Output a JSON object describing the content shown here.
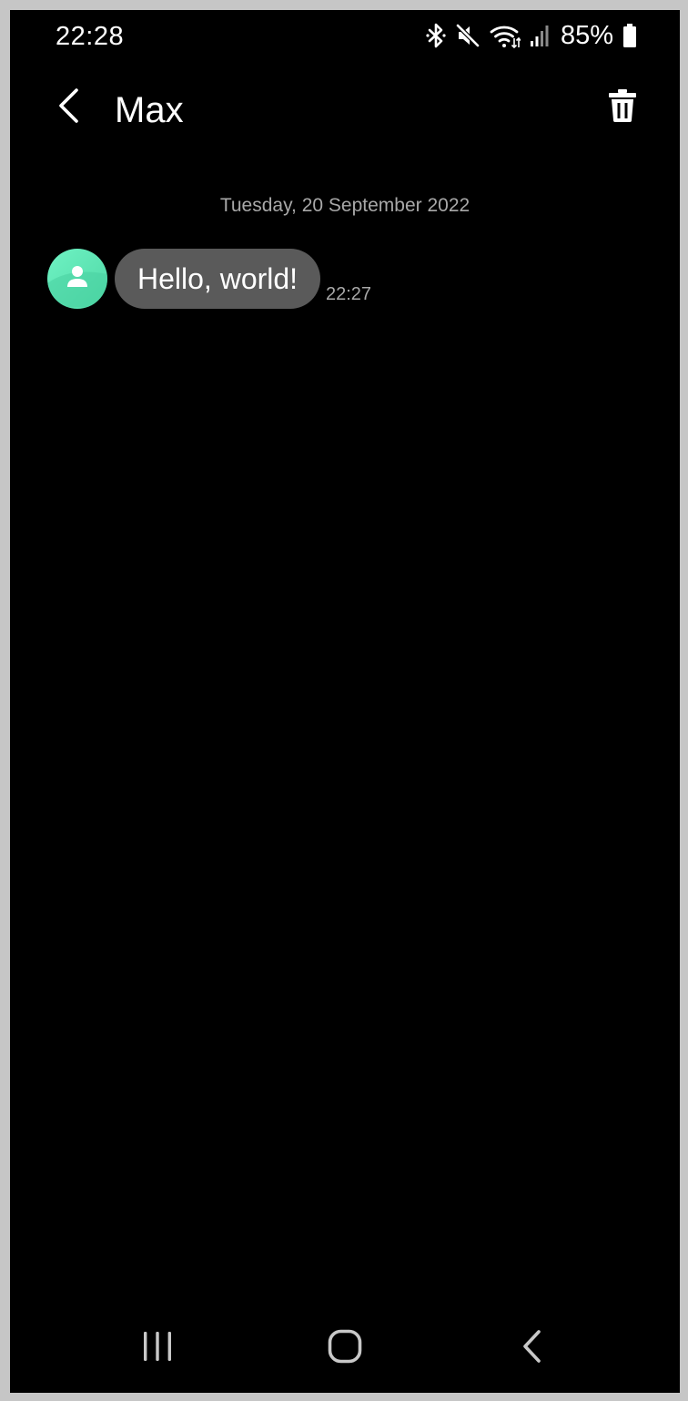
{
  "status_bar": {
    "time": "22:28",
    "battery_percent": "85%",
    "icons": [
      "bluetooth-icon",
      "mute-icon",
      "wifi-icon",
      "signal-icon",
      "battery-icon"
    ]
  },
  "header": {
    "title": "Max",
    "back_icon": "chevron-left-icon",
    "delete_icon": "trash-icon"
  },
  "conversation": {
    "date_divider": "Tuesday, 20 September 2022",
    "messages": [
      {
        "text": "Hello, world!",
        "time": "22:27",
        "direction": "incoming",
        "avatar_icon": "person-icon"
      }
    ]
  },
  "nav_bar": {
    "recents_icon": "recents-icon",
    "home_icon": "home-icon",
    "back_icon": "back-icon"
  },
  "colors": {
    "background": "#000000",
    "bubble": "#5a5a5a",
    "avatar": "#5ee3b3",
    "secondary_text": "#a8a8a8",
    "frame": "#c6c6c6"
  }
}
